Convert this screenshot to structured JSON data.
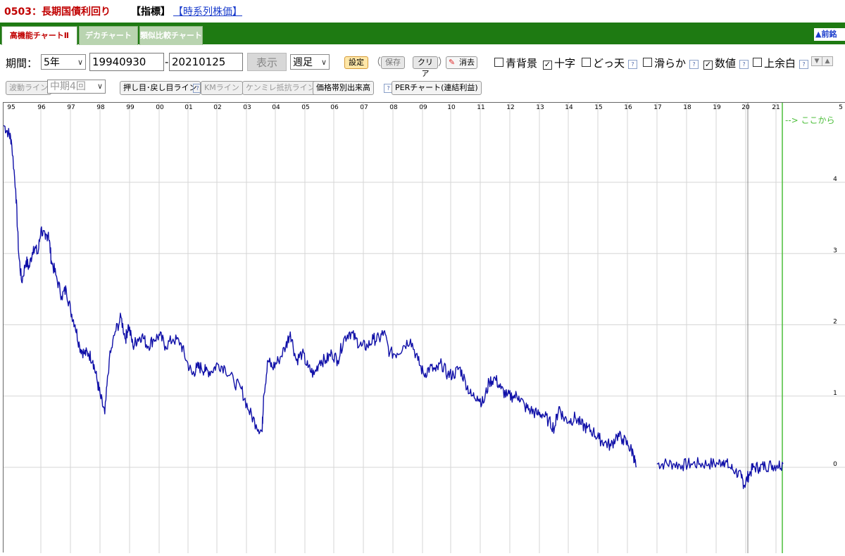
{
  "header": {
    "code_title": "0503：長期国債利回り",
    "indicator_label": "【指標】",
    "timeseries_link": "【時系列株価】"
  },
  "tabs": [
    {
      "label": "高機能チャートⅡ",
      "active": true
    },
    {
      "label": "デカチャート",
      "active": false
    },
    {
      "label": "類似比較チャート",
      "active": false
    }
  ],
  "tab_right_label": "▲前銘",
  "controls": {
    "period_label": "期間：",
    "period_value": "5年",
    "start_date": "19940930",
    "dash": "-",
    "end_date": "20210125",
    "display_button": "表示",
    "interval_value": "週足",
    "settings_button": "設定",
    "save_button": "保存",
    "clear_button": "クリア",
    "erase_button": "消去",
    "paren_open": "（",
    "paren_close": "）",
    "checkboxes": [
      {
        "label": "青背景",
        "checked": false
      },
      {
        "label": "十字",
        "checked": true
      },
      {
        "label": "どっ天",
        "checked": false
      },
      {
        "label": "滑らか",
        "checked": false
      },
      {
        "label": "数値",
        "checked": true
      },
      {
        "label": "上余白",
        "checked": false
      }
    ]
  },
  "toolbar2": {
    "wave_line": "波動ライン",
    "mid_term": "中期4回",
    "push_line": "押し目･戻し目ライン",
    "km_line": "KMライン",
    "kenmire_line": "ケンミレ抵抗ライン",
    "volume_by_price": "価格帯別出来高",
    "per_chart": "PERチャート(連結利益)"
  },
  "chart_data": {
    "type": "line",
    "x_axis_labels": [
      "95",
      "96",
      "97",
      "98",
      "99",
      "00",
      "01",
      "02",
      "03",
      "04",
      "05",
      "06",
      "07",
      "08",
      "09",
      "10",
      "11",
      "12",
      "13",
      "14",
      "15",
      "16",
      "17",
      "18",
      "19",
      "20",
      "21",
      "5"
    ],
    "y_axis_labels": [
      "4",
      "3",
      "2",
      "1",
      "0"
    ],
    "annotation": "--> ここから",
    "ylim": [
      -0.3,
      4.9
    ],
    "grid": true,
    "series": [
      {
        "color": "#1010a8",
        "segments": [
          {
            "x": [
              1994.75,
              1994.9,
              1995.0,
              1995.15,
              1995.25,
              1995.35,
              1995.5,
              1995.6,
              1995.75,
              1995.9,
              1996.0,
              1996.15,
              1996.25,
              1996.35,
              1996.5,
              1996.7,
              1996.85,
              1997.0,
              1997.15,
              1997.3,
              1997.45,
              1997.6,
              1997.75,
              1997.9,
              1998.0,
              1998.15,
              1998.3,
              1998.5,
              1998.7,
              1998.85,
              1998.95,
              1999.1,
              1999.25,
              1999.4,
              1999.6,
              1999.8,
              2000.0,
              2000.2,
              2000.45,
              2000.7,
              2000.9,
              2001.1,
              2001.25,
              2001.4,
              2001.55,
              2001.75,
              2001.95,
              2002.2,
              2002.5,
              2002.75,
              2003.0,
              2003.25,
              2003.45,
              2003.5,
              2003.65,
              2003.8,
              2004.0,
              2004.25,
              2004.4,
              2004.6,
              2004.8,
              2005.0,
              2005.2,
              2005.4,
              2005.6,
              2005.8,
              2006.0,
              2006.2,
              2006.4,
              2006.6,
              2006.8,
              2007.0,
              2007.2,
              2007.4,
              2007.55,
              2007.75,
              2008.0,
              2008.2,
              2008.45,
              2008.7,
              2008.9,
              2009.1,
              2009.3,
              2009.5,
              2009.7,
              2009.9,
              2010.1,
              2010.3,
              2010.5,
              2010.7,
              2010.9,
              2011.1,
              2011.3,
              2011.5,
              2011.7,
              2011.9,
              2012.1,
              2012.3,
              2012.5,
              2012.7,
              2012.9,
              2013.1,
              2013.3,
              2013.45,
              2013.6,
              2013.8,
              2014.0,
              2014.2,
              2014.4,
              2014.6,
              2014.8,
              2015.0,
              2015.2,
              2015.4,
              2015.6,
              2015.8,
              2015.95,
              2016.05
            ],
            "y": [
              4.8,
              4.7,
              4.6,
              3.9,
              3.0,
              2.6,
              2.9,
              2.8,
              3.1,
              3.0,
              3.35,
              3.2,
              3.3,
              2.9,
              2.7,
              2.4,
              2.5,
              2.2,
              2.0,
              1.7,
              1.6,
              1.6,
              1.5,
              1.2,
              1.0,
              0.75,
              1.5,
              1.9,
              2.1,
              1.8,
              2.0,
              1.7,
              1.8,
              1.85,
              1.7,
              1.8,
              1.85,
              1.7,
              1.8,
              1.75,
              1.5,
              1.3,
              1.4,
              1.4,
              1.35,
              1.35,
              1.45,
              1.4,
              1.2,
              1.1,
              0.8,
              0.6,
              0.5,
              1.0,
              1.5,
              1.4,
              1.5,
              1.7,
              1.9,
              1.5,
              1.6,
              1.4,
              1.3,
              1.5,
              1.5,
              1.6,
              1.5,
              1.8,
              1.9,
              1.8,
              1.7,
              1.7,
              1.8,
              1.8,
              1.9,
              1.6,
              1.6,
              1.7,
              1.8,
              1.5,
              1.3,
              1.4,
              1.35,
              1.45,
              1.3,
              1.3,
              1.4,
              1.2,
              1.0,
              1.0,
              0.9,
              1.2,
              1.25,
              1.1,
              1.0,
              1.0,
              1.0,
              0.85,
              0.8,
              0.75,
              0.75,
              0.65,
              0.55,
              0.85,
              0.7,
              0.65,
              0.7,
              0.6,
              0.55,
              0.5,
              0.4,
              0.35,
              0.3,
              0.45,
              0.4,
              0.3,
              0.2,
              0.0
            ]
          },
          {
            "x": [
              2016.75,
              2017.0,
              2017.3,
              2017.6,
              2017.9,
              2018.2,
              2018.5,
              2018.8,
              2019.0,
              2019.2,
              2019.4,
              2019.6,
              2019.7,
              2019.85,
              2020.0,
              2020.2,
              2020.4,
              2020.6,
              2020.8,
              2021.0
            ],
            "y": [
              0.05,
              0.05,
              0.05,
              0.03,
              0.05,
              0.05,
              0.05,
              0.05,
              0.1,
              0.0,
              -0.05,
              -0.15,
              -0.25,
              -0.1,
              0.0,
              0.0,
              0.02,
              0.03,
              0.03,
              0.05
            ]
          }
        ]
      }
    ]
  }
}
